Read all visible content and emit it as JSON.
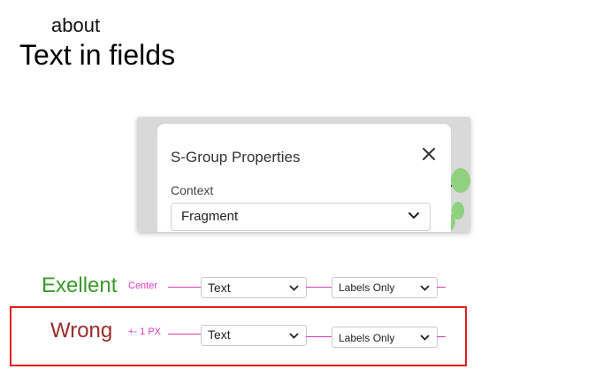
{
  "header": {
    "pretitle": "about",
    "title": "Text in fields"
  },
  "dialog": {
    "title": "S-Group Properties",
    "context_label": "Context",
    "context_value": "Fragment"
  },
  "examples": [
    {
      "label": "Exellent",
      "note": "Center",
      "field1": "Text",
      "field2": "Labels Only"
    },
    {
      "label": "Wrong",
      "note": "+- 1 PX",
      "field1": "Text",
      "field2": "Labels Only"
    }
  ],
  "colors": {
    "excellent": "#3a9a2a",
    "wrong": "#9b2b2b",
    "annotation": "#e03bc2",
    "frame": "#e21d1d"
  }
}
